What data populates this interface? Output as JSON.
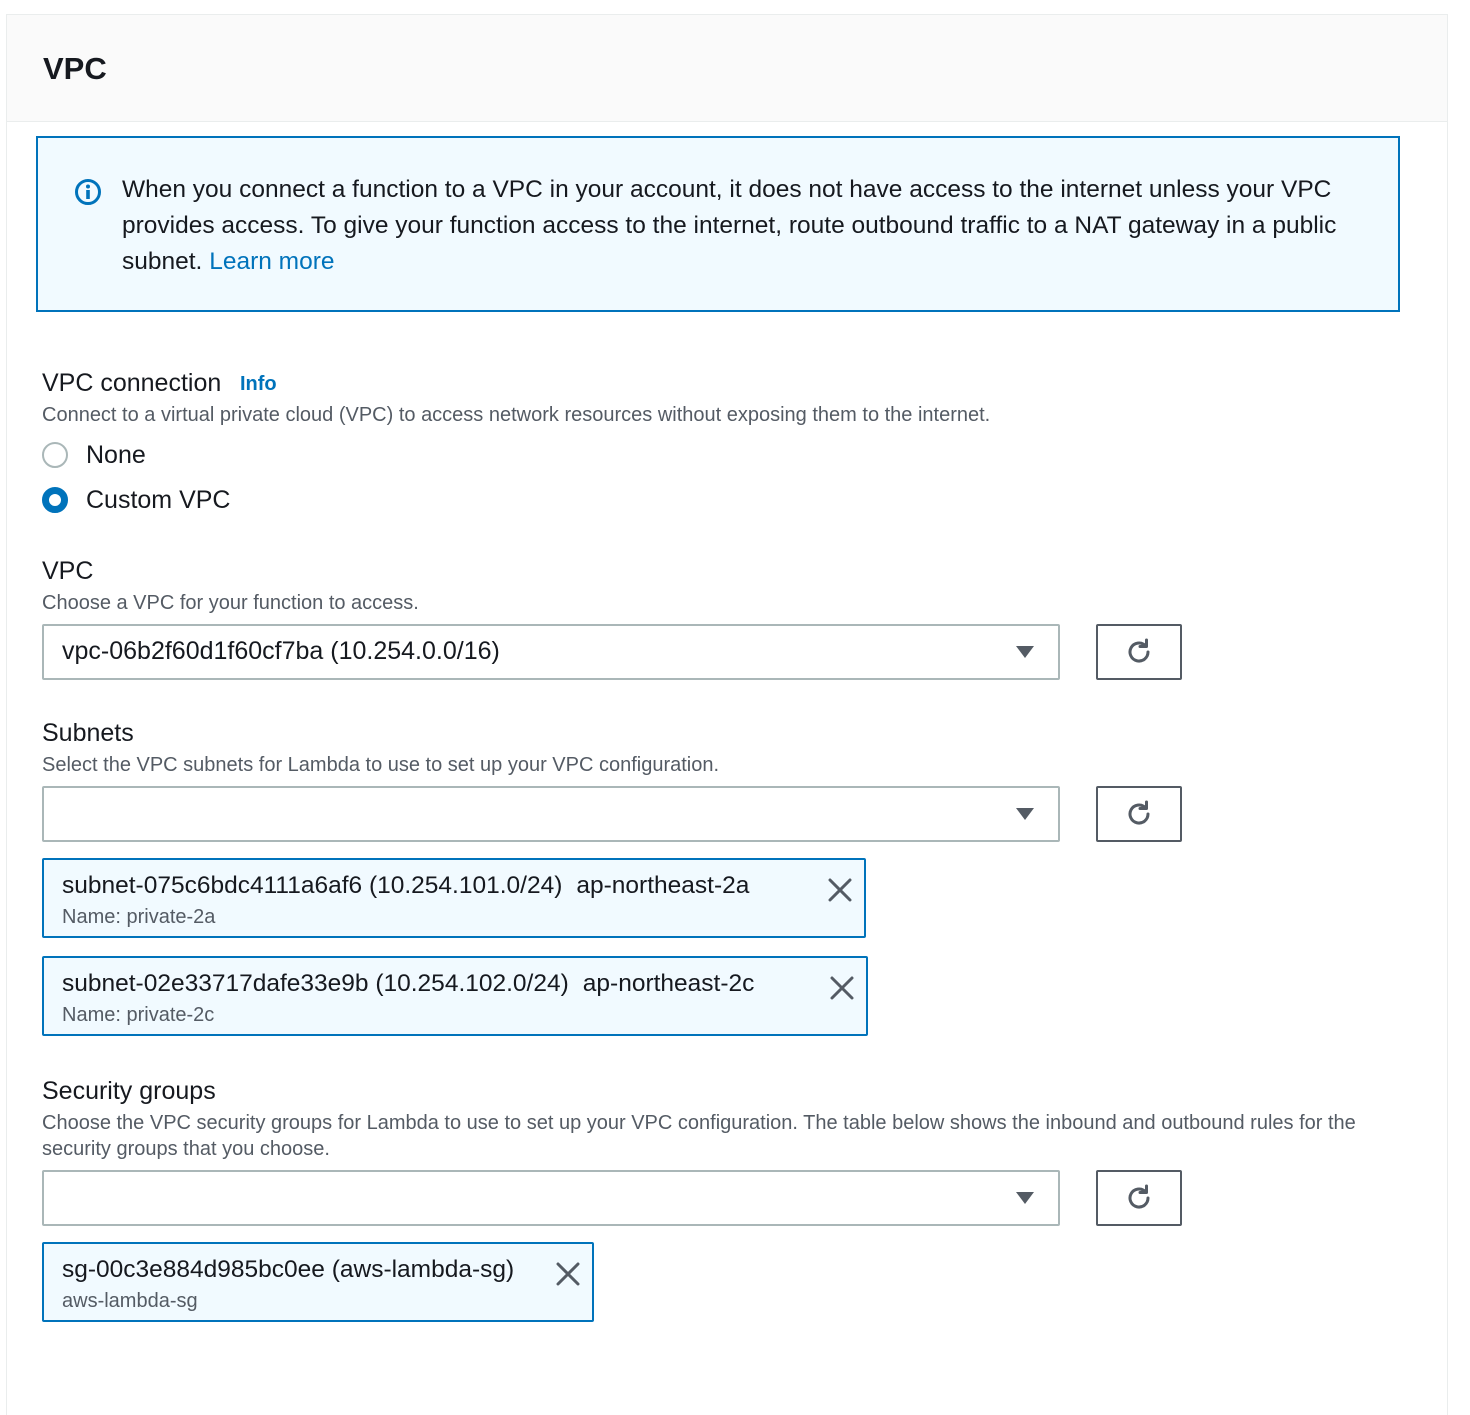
{
  "panel": {
    "title": "VPC"
  },
  "alert": {
    "text": "When you connect a function to a VPC in your account, it does not have access to the internet unless your VPC provides access. To give your function access to the internet, route outbound traffic to a NAT gateway in a public subnet.",
    "link_label": "Learn more",
    "icon": "info-circle-icon",
    "color": "#0073bb"
  },
  "vpc_connection": {
    "label": "VPC connection",
    "info_label": "Info",
    "description": "Connect to a virtual private cloud (VPC) to access network resources without exposing them to the internet.",
    "options": [
      {
        "label": "None",
        "selected": false
      },
      {
        "label": "Custom VPC",
        "selected": true
      }
    ]
  },
  "vpc": {
    "label": "VPC",
    "description": "Choose a VPC for your function to access.",
    "selected_value": "vpc-06b2f60d1f60cf7ba (10.254.0.0/16)"
  },
  "subnets": {
    "label": "Subnets",
    "description": "Select the VPC subnets for Lambda to use to set up your VPC configuration.",
    "selected_value": "",
    "tokens": [
      {
        "id": "subnet-075c6bdc4111a6af6 (10.254.101.0/24)",
        "az": "ap-northeast-2a",
        "name": "Name: private-2a"
      },
      {
        "id": "subnet-02e33717dafe33e9b (10.254.102.0/24)",
        "az": "ap-northeast-2c",
        "name": "Name: private-2c"
      }
    ]
  },
  "security_groups": {
    "label": "Security groups",
    "description": "Choose the VPC security groups for Lambda to use to set up your VPC configuration. The table below shows the inbound and outbound rules for the security groups that you choose.",
    "selected_value": "",
    "tokens": [
      {
        "id": "sg-00c3e884d985bc0ee (aws-lambda-sg)",
        "name": "aws-lambda-sg"
      }
    ]
  },
  "icons": {
    "refresh": "refresh-icon",
    "dropdown": "caret-down-icon",
    "remove": "close-icon"
  }
}
